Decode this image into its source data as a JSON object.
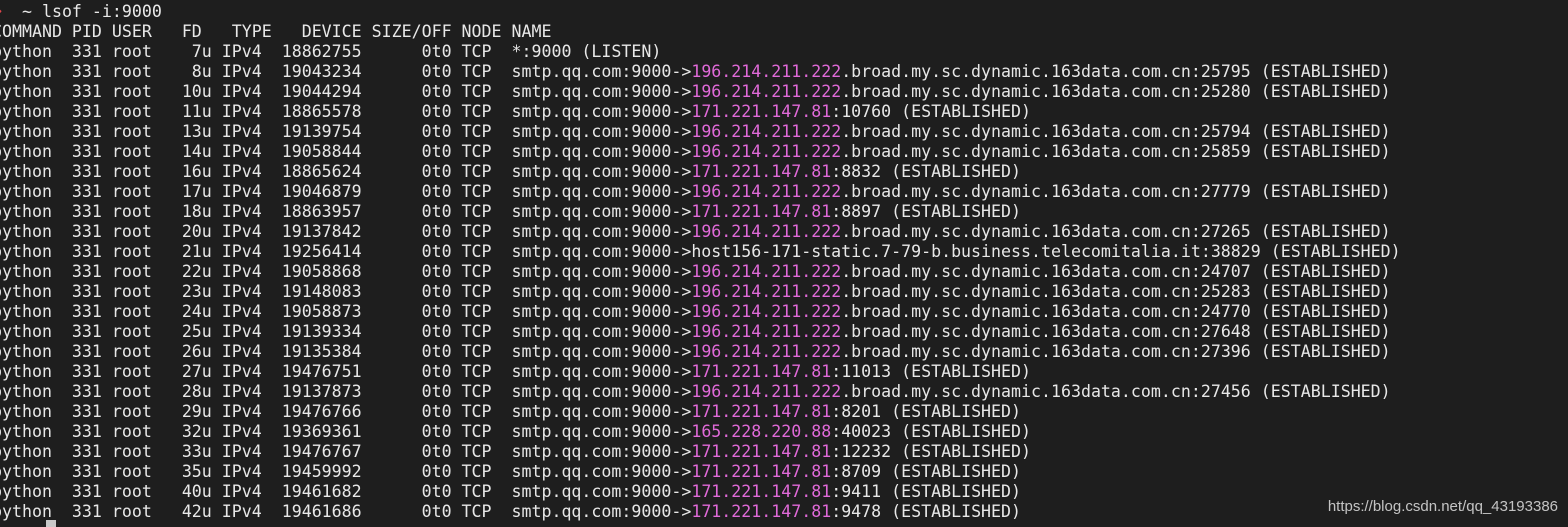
{
  "prompt": {
    "arrow": "➜",
    "text": "  ~ lsof -i:9000"
  },
  "header": "COMMAND PID USER   FD   TYPE   DEVICE SIZE/OFF NODE NAME",
  "rows": [
    {
      "cmd": "python",
      "pid": "331",
      "user": "root",
      "fd": "7u",
      "type": "IPv4",
      "device": "18862755",
      "size": "0t0",
      "node": "TCP",
      "name_pre": "*:9000 (LISTEN)",
      "ip": "",
      "name_post": ""
    },
    {
      "cmd": "python",
      "pid": "331",
      "user": "root",
      "fd": "8u",
      "type": "IPv4",
      "device": "19043234",
      "size": "0t0",
      "node": "TCP",
      "name_pre": "smtp.qq.com:9000->",
      "ip": "196.214.211.222",
      "name_post": ".broad.my.sc.dynamic.163data.com.cn:25795 (ESTABLISHED)"
    },
    {
      "cmd": "python",
      "pid": "331",
      "user": "root",
      "fd": "10u",
      "type": "IPv4",
      "device": "19044294",
      "size": "0t0",
      "node": "TCP",
      "name_pre": "smtp.qq.com:9000->",
      "ip": "196.214.211.222",
      "name_post": ".broad.my.sc.dynamic.163data.com.cn:25280 (ESTABLISHED)"
    },
    {
      "cmd": "python",
      "pid": "331",
      "user": "root",
      "fd": "11u",
      "type": "IPv4",
      "device": "18865578",
      "size": "0t0",
      "node": "TCP",
      "name_pre": "smtp.qq.com:9000->",
      "ip": "171.221.147.81",
      "name_post": ":10760 (ESTABLISHED)"
    },
    {
      "cmd": "python",
      "pid": "331",
      "user": "root",
      "fd": "13u",
      "type": "IPv4",
      "device": "19139754",
      "size": "0t0",
      "node": "TCP",
      "name_pre": "smtp.qq.com:9000->",
      "ip": "196.214.211.222",
      "name_post": ".broad.my.sc.dynamic.163data.com.cn:25794 (ESTABLISHED)"
    },
    {
      "cmd": "python",
      "pid": "331",
      "user": "root",
      "fd": "14u",
      "type": "IPv4",
      "device": "19058844",
      "size": "0t0",
      "node": "TCP",
      "name_pre": "smtp.qq.com:9000->",
      "ip": "196.214.211.222",
      "name_post": ".broad.my.sc.dynamic.163data.com.cn:25859 (ESTABLISHED)"
    },
    {
      "cmd": "python",
      "pid": "331",
      "user": "root",
      "fd": "16u",
      "type": "IPv4",
      "device": "18865624",
      "size": "0t0",
      "node": "TCP",
      "name_pre": "smtp.qq.com:9000->",
      "ip": "171.221.147.81",
      "name_post": ":8832 (ESTABLISHED)"
    },
    {
      "cmd": "python",
      "pid": "331",
      "user": "root",
      "fd": "17u",
      "type": "IPv4",
      "device": "19046879",
      "size": "0t0",
      "node": "TCP",
      "name_pre": "smtp.qq.com:9000->",
      "ip": "196.214.211.222",
      "name_post": ".broad.my.sc.dynamic.163data.com.cn:27779 (ESTABLISHED)"
    },
    {
      "cmd": "python",
      "pid": "331",
      "user": "root",
      "fd": "18u",
      "type": "IPv4",
      "device": "18863957",
      "size": "0t0",
      "node": "TCP",
      "name_pre": "smtp.qq.com:9000->",
      "ip": "171.221.147.81",
      "name_post": ":8897 (ESTABLISHED)"
    },
    {
      "cmd": "python",
      "pid": "331",
      "user": "root",
      "fd": "20u",
      "type": "IPv4",
      "device": "19137842",
      "size": "0t0",
      "node": "TCP",
      "name_pre": "smtp.qq.com:9000->",
      "ip": "196.214.211.222",
      "name_post": ".broad.my.sc.dynamic.163data.com.cn:27265 (ESTABLISHED)"
    },
    {
      "cmd": "python",
      "pid": "331",
      "user": "root",
      "fd": "21u",
      "type": "IPv4",
      "device": "19256414",
      "size": "0t0",
      "node": "TCP",
      "name_pre": "smtp.qq.com:9000->host156-171-static.7-79-b.business.telecomitalia.it:38829 (ESTABLISHED)",
      "ip": "",
      "name_post": ""
    },
    {
      "cmd": "python",
      "pid": "331",
      "user": "root",
      "fd": "22u",
      "type": "IPv4",
      "device": "19058868",
      "size": "0t0",
      "node": "TCP",
      "name_pre": "smtp.qq.com:9000->",
      "ip": "196.214.211.222",
      "name_post": ".broad.my.sc.dynamic.163data.com.cn:24707 (ESTABLISHED)"
    },
    {
      "cmd": "python",
      "pid": "331",
      "user": "root",
      "fd": "23u",
      "type": "IPv4",
      "device": "19148083",
      "size": "0t0",
      "node": "TCP",
      "name_pre": "smtp.qq.com:9000->",
      "ip": "196.214.211.222",
      "name_post": ".broad.my.sc.dynamic.163data.com.cn:25283 (ESTABLISHED)"
    },
    {
      "cmd": "python",
      "pid": "331",
      "user": "root",
      "fd": "24u",
      "type": "IPv4",
      "device": "19058873",
      "size": "0t0",
      "node": "TCP",
      "name_pre": "smtp.qq.com:9000->",
      "ip": "196.214.211.222",
      "name_post": ".broad.my.sc.dynamic.163data.com.cn:24770 (ESTABLISHED)"
    },
    {
      "cmd": "python",
      "pid": "331",
      "user": "root",
      "fd": "25u",
      "type": "IPv4",
      "device": "19139334",
      "size": "0t0",
      "node": "TCP",
      "name_pre": "smtp.qq.com:9000->",
      "ip": "196.214.211.222",
      "name_post": ".broad.my.sc.dynamic.163data.com.cn:27648 (ESTABLISHED)"
    },
    {
      "cmd": "python",
      "pid": "331",
      "user": "root",
      "fd": "26u",
      "type": "IPv4",
      "device": "19135384",
      "size": "0t0",
      "node": "TCP",
      "name_pre": "smtp.qq.com:9000->",
      "ip": "196.214.211.222",
      "name_post": ".broad.my.sc.dynamic.163data.com.cn:27396 (ESTABLISHED)"
    },
    {
      "cmd": "python",
      "pid": "331",
      "user": "root",
      "fd": "27u",
      "type": "IPv4",
      "device": "19476751",
      "size": "0t0",
      "node": "TCP",
      "name_pre": "smtp.qq.com:9000->",
      "ip": "171.221.147.81",
      "name_post": ":11013 (ESTABLISHED)"
    },
    {
      "cmd": "python",
      "pid": "331",
      "user": "root",
      "fd": "28u",
      "type": "IPv4",
      "device": "19137873",
      "size": "0t0",
      "node": "TCP",
      "name_pre": "smtp.qq.com:9000->",
      "ip": "196.214.211.222",
      "name_post": ".broad.my.sc.dynamic.163data.com.cn:27456 (ESTABLISHED)"
    },
    {
      "cmd": "python",
      "pid": "331",
      "user": "root",
      "fd": "29u",
      "type": "IPv4",
      "device": "19476766",
      "size": "0t0",
      "node": "TCP",
      "name_pre": "smtp.qq.com:9000->",
      "ip": "171.221.147.81",
      "name_post": ":8201 (ESTABLISHED)"
    },
    {
      "cmd": "python",
      "pid": "331",
      "user": "root",
      "fd": "32u",
      "type": "IPv4",
      "device": "19369361",
      "size": "0t0",
      "node": "TCP",
      "name_pre": "smtp.qq.com:9000->",
      "ip": "165.228.220.88",
      "name_post": ":40023 (ESTABLISHED)"
    },
    {
      "cmd": "python",
      "pid": "331",
      "user": "root",
      "fd": "33u",
      "type": "IPv4",
      "device": "19476767",
      "size": "0t0",
      "node": "TCP",
      "name_pre": "smtp.qq.com:9000->",
      "ip": "171.221.147.81",
      "name_post": ":12232 (ESTABLISHED)"
    },
    {
      "cmd": "python",
      "pid": "331",
      "user": "root",
      "fd": "35u",
      "type": "IPv4",
      "device": "19459992",
      "size": "0t0",
      "node": "TCP",
      "name_pre": "smtp.qq.com:9000->",
      "ip": "171.221.147.81",
      "name_post": ":8709 (ESTABLISHED)"
    },
    {
      "cmd": "python",
      "pid": "331",
      "user": "root",
      "fd": "40u",
      "type": "IPv4",
      "device": "19461682",
      "size": "0t0",
      "node": "TCP",
      "name_pre": "smtp.qq.com:9000->",
      "ip": "171.221.147.81",
      "name_post": ":9411 (ESTABLISHED)"
    },
    {
      "cmd": "python",
      "pid": "331",
      "user": "root",
      "fd": "42u",
      "type": "IPv4",
      "device": "19461686",
      "size": "0t0",
      "node": "TCP",
      "name_pre": "smtp.qq.com:9000->",
      "ip": "171.221.147.81",
      "name_post": ":9478 (ESTABLISHED)"
    }
  ],
  "watermark": "https://blog.csdn.net/qq_43193386",
  "colors": {
    "background": "#1e1e1e",
    "text": "#e8e8e8",
    "ip_highlight": "#e06ad8",
    "prompt_arrow": "#e0454a"
  }
}
